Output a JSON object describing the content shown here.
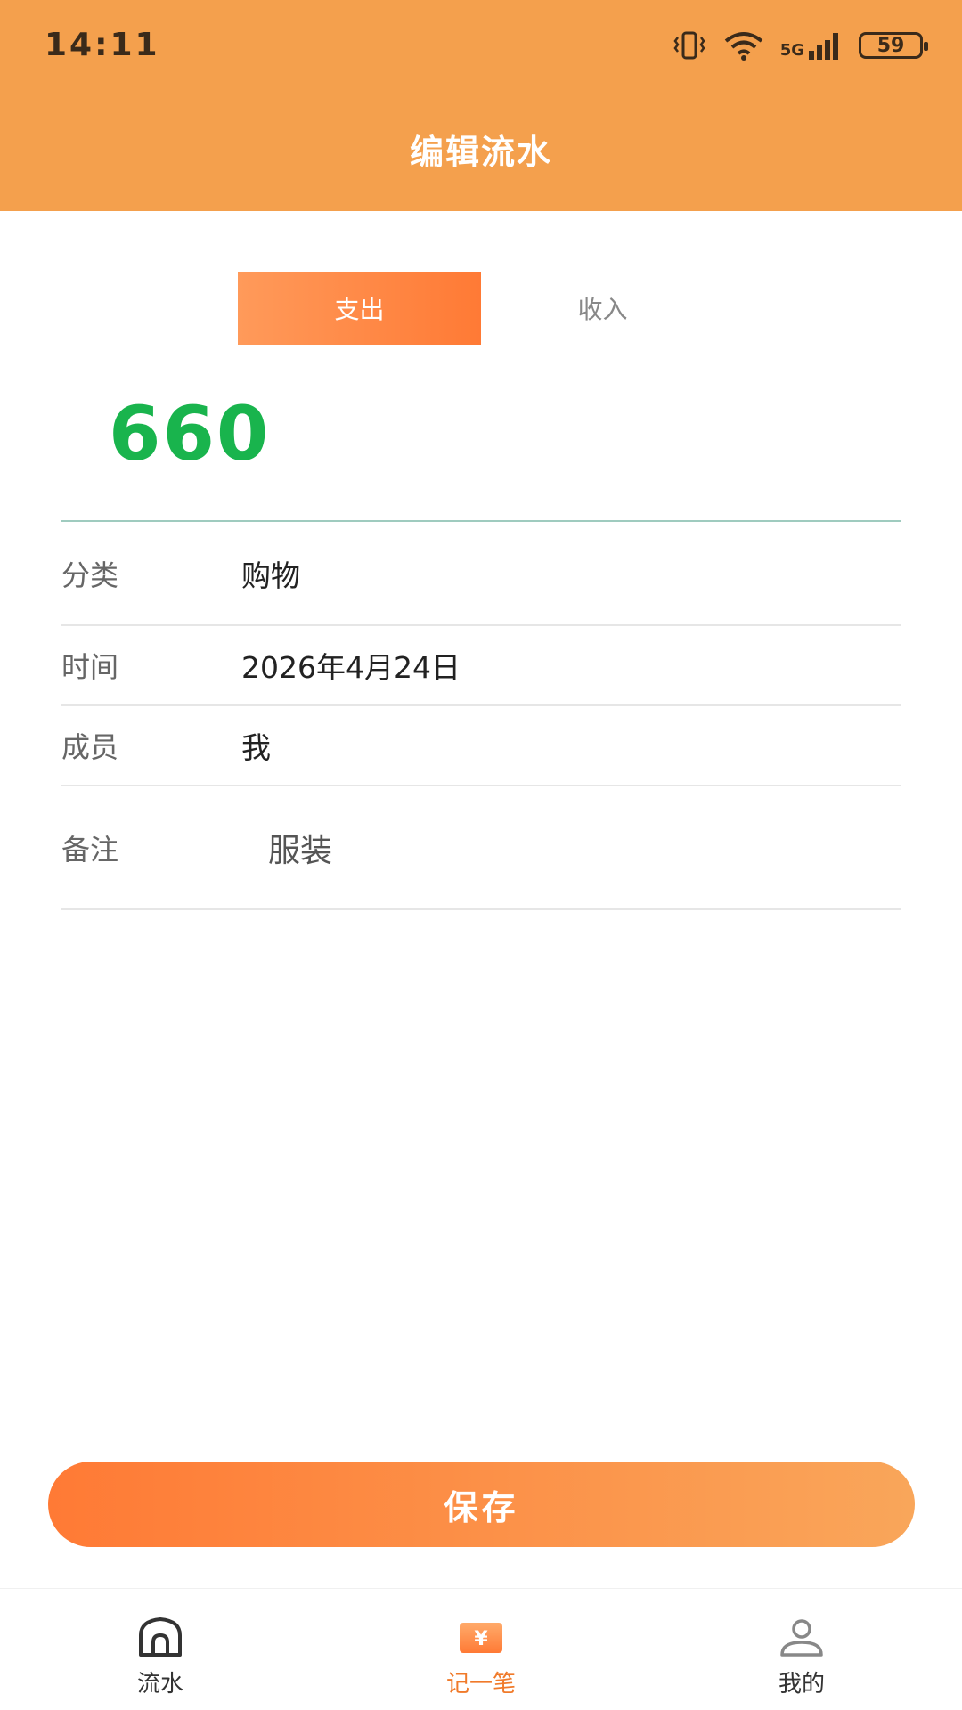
{
  "status_bar": {
    "time": "14:11",
    "network": "5G",
    "battery": "59"
  },
  "header": {
    "title": "编辑流水"
  },
  "type_tabs": [
    {
      "label": "支出",
      "active": true
    },
    {
      "label": "收入",
      "active": false
    }
  ],
  "amount": {
    "value": "660",
    "color": "#19b44d"
  },
  "form": {
    "category": {
      "label": "分类",
      "value": "购物"
    },
    "date": {
      "label": "时间",
      "value": "2026年4月24日"
    },
    "member": {
      "label": "成员",
      "value": "我"
    },
    "note": {
      "label": "备注",
      "value": "服装"
    }
  },
  "save_button": {
    "label": "保存"
  },
  "bottom_nav": [
    {
      "label": "流水",
      "icon": "home-icon",
      "active": false
    },
    {
      "label": "记一笔",
      "icon": "yen-note-icon",
      "active": true
    },
    {
      "label": "我的",
      "icon": "user-icon",
      "active": false
    }
  ],
  "colors": {
    "header": "#f4a04d",
    "accent": "#ff7a35",
    "active_nav": "#f07a2a"
  }
}
